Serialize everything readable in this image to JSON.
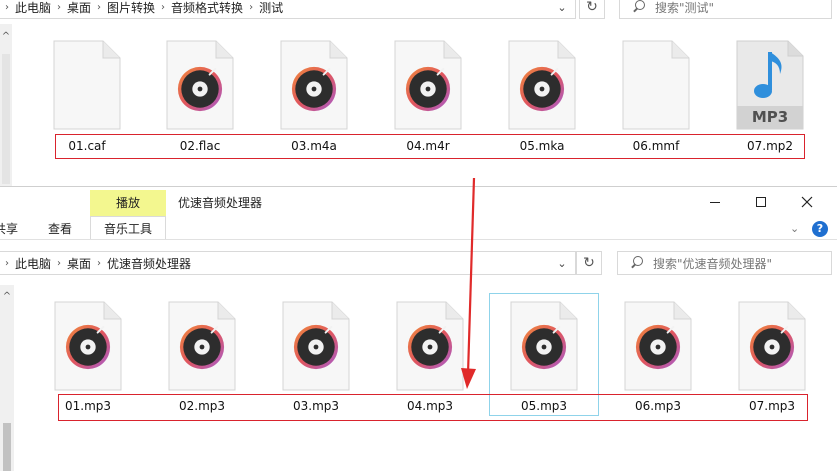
{
  "back_window": {
    "breadcrumb": [
      "此电脑",
      "桌面",
      "图片转换",
      "音频格式转换",
      "测试"
    ],
    "search_placeholder": "搜索\"测试\"",
    "files": [
      {
        "name": "01.caf",
        "icon": "blank-file-icon"
      },
      {
        "name": "02.flac",
        "icon": "audio-file-icon"
      },
      {
        "name": "03.m4a",
        "icon": "audio-file-icon"
      },
      {
        "name": "04.m4r",
        "icon": "audio-file-icon"
      },
      {
        "name": "05.mka",
        "icon": "audio-file-icon"
      },
      {
        "name": "06.mmf",
        "icon": "blank-file-icon"
      },
      {
        "name": "07.mp2",
        "icon": "mp3-file-icon"
      }
    ],
    "mp3_icon_text": "MP3"
  },
  "front_window": {
    "context_tab": "播放",
    "title": "优速音频处理器",
    "tabs": [
      "共享",
      "查看",
      "音乐工具"
    ],
    "tab_share_visible": "共享",
    "breadcrumb": [
      "此电脑",
      "桌面",
      "优速音频处理器"
    ],
    "search_placeholder": "搜索\"优速音频处理器\"",
    "help_label": "?",
    "files": [
      {
        "name": "01.mp3"
      },
      {
        "name": "02.mp3"
      },
      {
        "name": "03.mp3"
      },
      {
        "name": "04.mp3"
      },
      {
        "name": "05.mp3"
      },
      {
        "name": "06.mp3"
      },
      {
        "name": "07.mp3"
      }
    ],
    "selected_index": 4
  },
  "colors": {
    "annotation_red": "#e02a2a",
    "context_tab_bg": "#f3f78f",
    "selection_border": "#8fd3ea"
  }
}
